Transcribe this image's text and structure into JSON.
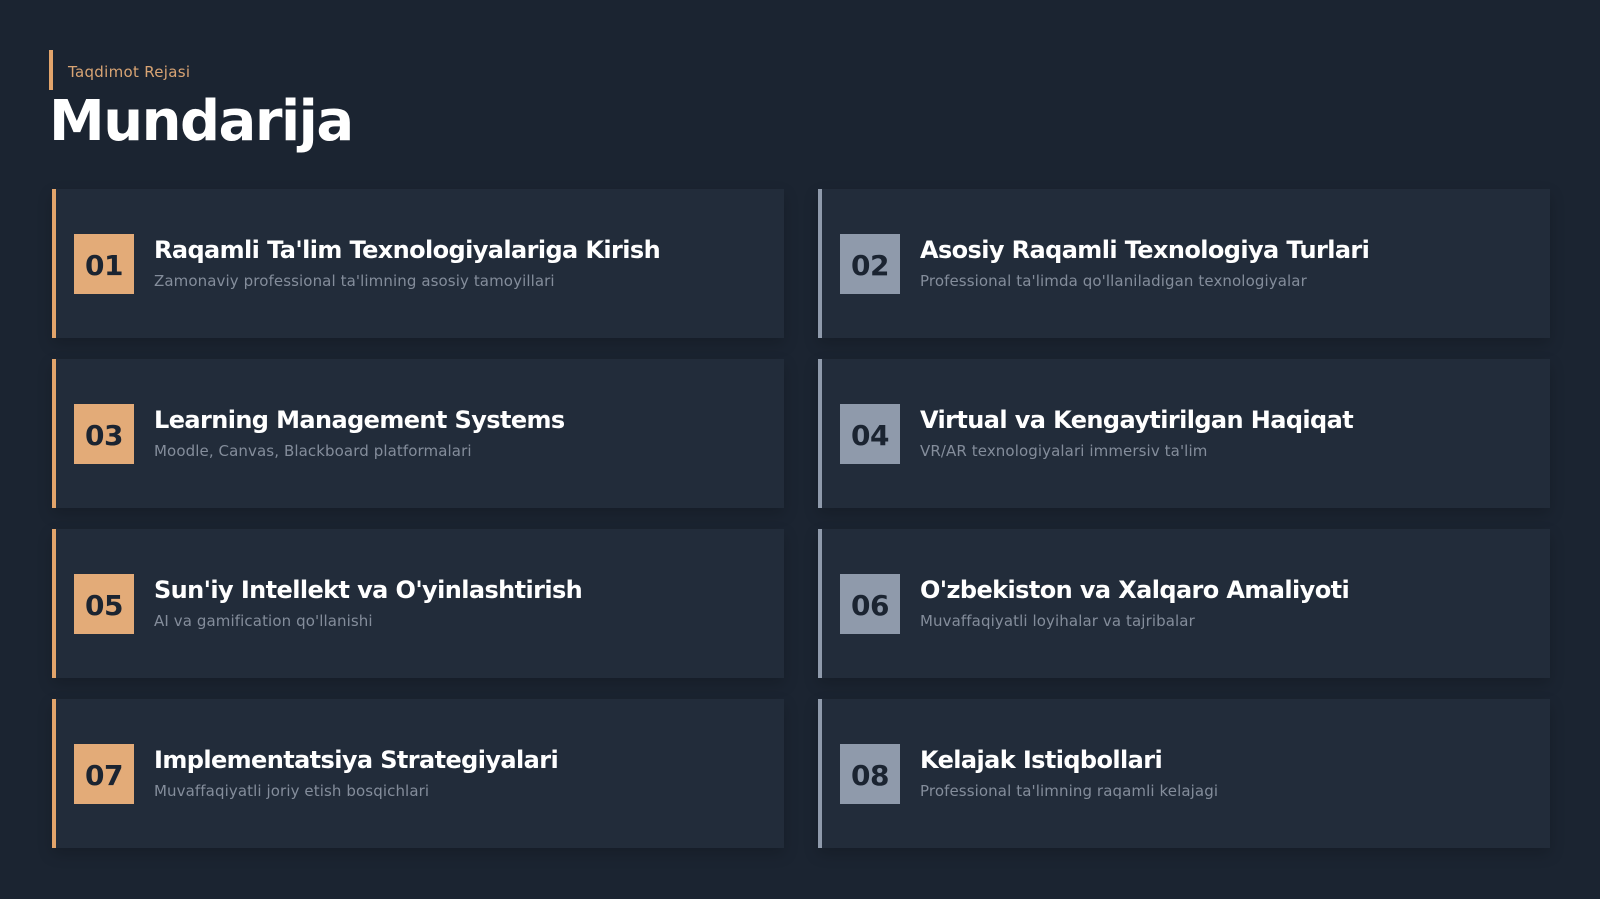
{
  "header": {
    "eyebrow": "Taqdimot Rejasi",
    "title": "Mundarija"
  },
  "items": [
    {
      "number": "01",
      "title": "Raqamli Ta'lim Texnologiyalariga Kirish",
      "subtitle": "Zamonaviy professional ta'limning asosiy tamoyillari"
    },
    {
      "number": "02",
      "title": "Asosiy Raqamli Texnologiya Turlari",
      "subtitle": "Professional ta'limda qo'llaniladigan texnologiyalar"
    },
    {
      "number": "03",
      "title": "Learning Management Systems",
      "subtitle": "Moodle, Canvas, Blackboard platformalari"
    },
    {
      "number": "04",
      "title": "Virtual va Kengaytirilgan Haqiqat",
      "subtitle": "VR/AR texnologiyalari immersiv ta'lim"
    },
    {
      "number": "05",
      "title": "Sun'iy Intellekt va O'yinlashtirish",
      "subtitle": "AI va gamification qo'llanishi"
    },
    {
      "number": "06",
      "title": "O'zbekiston va Xalqaro Amaliyoti",
      "subtitle": "Muvaffaqiyatli loyihalar va tajribalar"
    },
    {
      "number": "07",
      "title": "Implementatsiya Strategiyalari",
      "subtitle": "Muvaffaqiyatli joriy etish bosqichlari"
    },
    {
      "number": "08",
      "title": "Kelajak Istiqbollari",
      "subtitle": "Professional ta'limning raqamli kelajagi"
    }
  ],
  "colors": {
    "background": "#1b2431",
    "card": "#222c3a",
    "accent_warm": "#e2a46b",
    "accent_cool": "#8f9aab"
  }
}
